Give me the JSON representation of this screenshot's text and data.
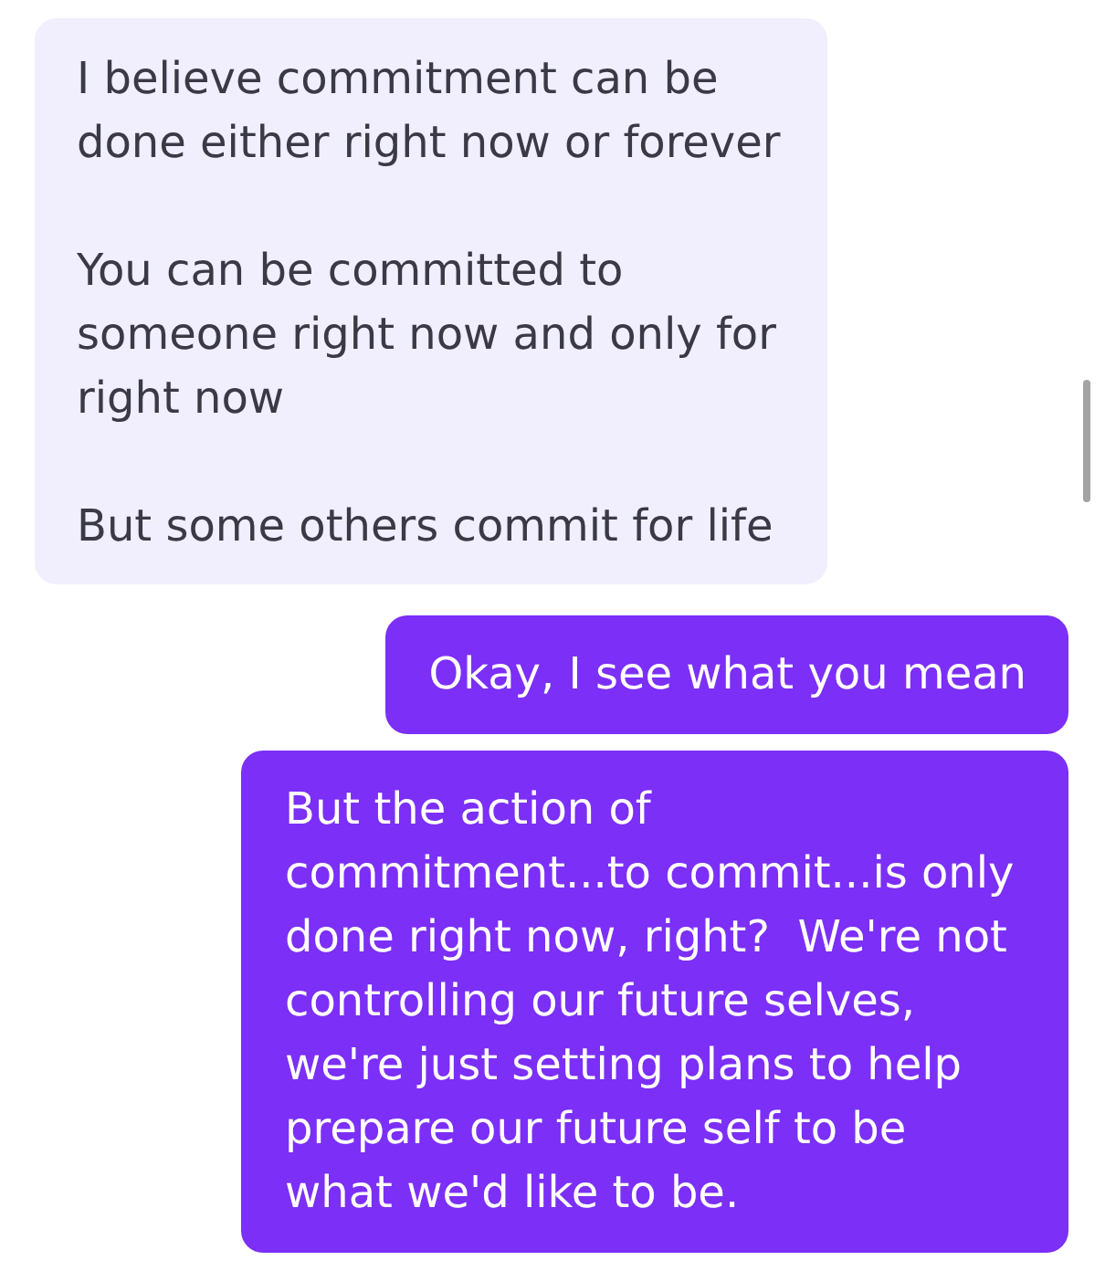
{
  "messages": [
    {
      "kind": "received",
      "paragraphs": [
        "I believe commitment can be done either right now or forever",
        "You can be committed to someone right now and only for right now",
        "But some others commit for life"
      ]
    },
    {
      "kind": "sent",
      "paragraphs": [
        "Okay, I see what you mean"
      ]
    },
    {
      "kind": "sent",
      "paragraphs": [
        "But the action of commitment...to commit...is only done right now, right?  We're not controlling our future selves, we're just setting plans to help prepare our future self to be what we'd like to be."
      ]
    }
  ]
}
